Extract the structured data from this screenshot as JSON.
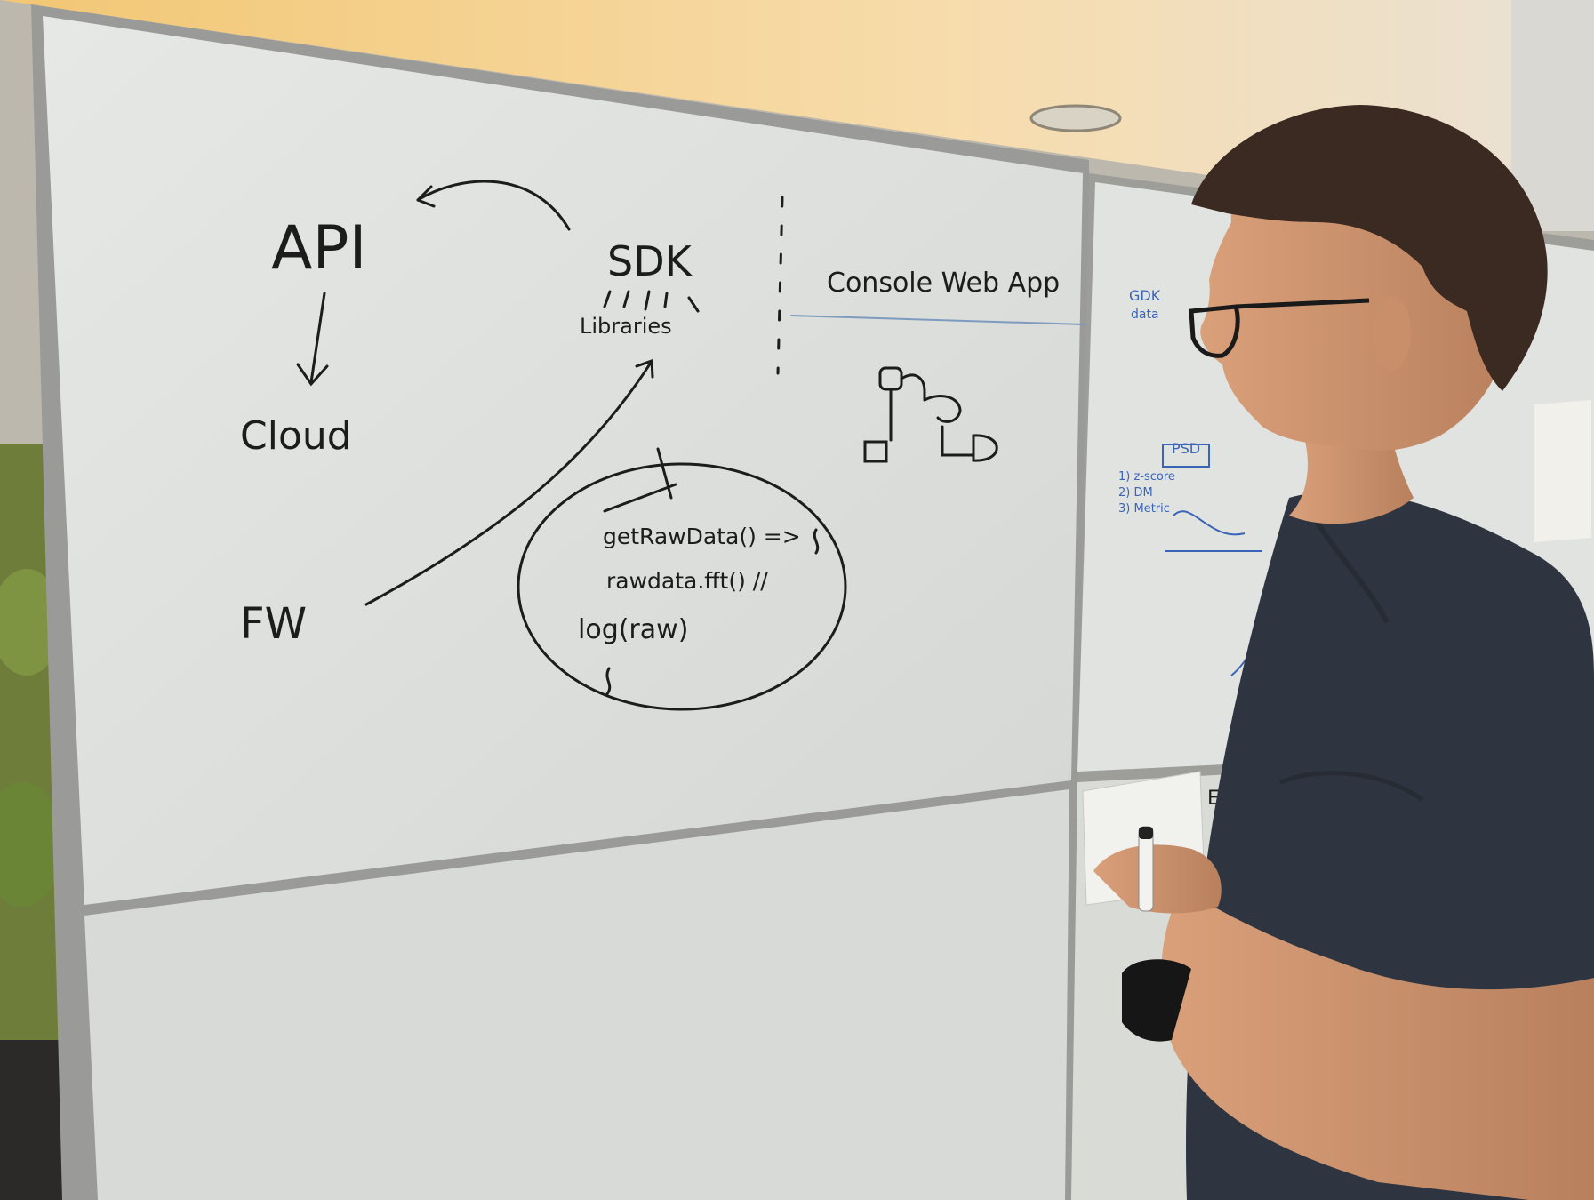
{
  "whiteboard": {
    "api": "API",
    "cloud": "Cloud",
    "sdk": "SDK",
    "libraries": "Libraries",
    "console_web_app": "Console Web App",
    "fw": "FW",
    "code_line_1": "getRawData() =>",
    "code_line_2": "rawdata.fft() //",
    "code_line_3": "log(raw)"
  },
  "side_board": {
    "line_1": "GDK",
    "line_2": "data",
    "line_3": "PSD",
    "line_4": "1) z-score",
    "line_5": "2) DM",
    "line_6": "3) Metric",
    "line_7": "EG"
  },
  "colors": {
    "marker_black": "#1c1c1c",
    "marker_blue": "#3a64b8",
    "board_white": "#e4e4e0",
    "shirt": "#2f3540"
  }
}
